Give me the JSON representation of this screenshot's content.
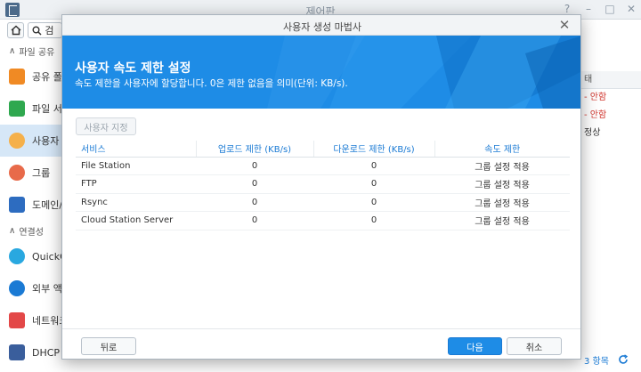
{
  "background": {
    "title": "제어판",
    "search_text": "검",
    "sections": [
      "파일 공유",
      "연결성"
    ],
    "items": [
      {
        "label": "공유 폴더",
        "color": "#f08a24"
      },
      {
        "label": "파일 서비스",
        "color": "#2fa84f"
      },
      {
        "label": "사용자",
        "color": "#f5b04a"
      },
      {
        "label": "그룹",
        "color": "#e86a4a"
      },
      {
        "label": "도메인/LDAP",
        "color": "#2d6cc0"
      },
      {
        "label": "QuickConnect",
        "color": "#29a8e0"
      },
      {
        "label": "외부 액세스",
        "color": "#1a7ad4"
      },
      {
        "label": "네트워크",
        "color": "#e34848"
      },
      {
        "label": "DHCP Server",
        "color": "#3a5e9c"
      }
    ],
    "right_col": {
      "header": "태",
      "rows": [
        "- 안함",
        "- 안함",
        "정상"
      ]
    },
    "footer_count": "3 항목"
  },
  "dialog": {
    "title": "사용자 생성 마법사",
    "heading": "사용자 속도 제한 설정",
    "description": "속도 제한을 사용자에 할당합니다. 0은 제한 없음을 의미(단위: KB/s).",
    "set_user_button": "사용자 지정",
    "columns": [
      "서비스",
      "업로드 제한 (KB/s)",
      "다운로드 제한 (KB/s)",
      "속도 제한"
    ],
    "rows": [
      {
        "service": "File Station",
        "upload": "0",
        "download": "0",
        "limit": "그룹 설정 적용"
      },
      {
        "service": "FTP",
        "upload": "0",
        "download": "0",
        "limit": "그룹 설정 적용"
      },
      {
        "service": "Rsync",
        "upload": "0",
        "download": "0",
        "limit": "그룹 설정 적용"
      },
      {
        "service": "Cloud Station Server",
        "upload": "0",
        "download": "0",
        "limit": "그룹 설정 적용"
      }
    ],
    "back_button": "뒤로",
    "next_button": "다음",
    "cancel_button": "취소",
    "accent_color": "#1e8ce6"
  }
}
